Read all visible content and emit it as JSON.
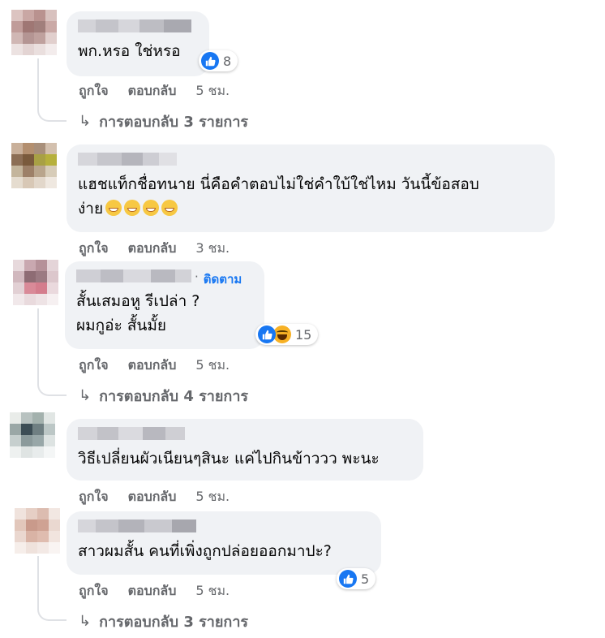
{
  "comments": [
    {
      "text_lines": [
        "พก.หรอ ใช่หรอ"
      ],
      "reaction_count": "8",
      "actions": {
        "like": "ถูกใจ",
        "reply": "ตอบกลับ",
        "time": "5 ชม."
      },
      "replies_label": "การตอบกลับ 3 รายการ"
    },
    {
      "text_lines": [
        "แฮชแท็กชื่อทนาย นี่คือคำตอบไม่ใช่คำใบ้ใช่ไหม วันนี้ข้อสอบ",
        "ง่าย"
      ],
      "actions": {
        "like": "ถูกใจ",
        "reply": "ตอบกลับ",
        "time": "3 ชม."
      }
    },
    {
      "follow_label": "ติดตาม",
      "text_lines": [
        "สั้นเสมอหู รีเปล่า ?",
        "ผมกูอ่ะ สั้นมั้ย"
      ],
      "reaction_count": "15",
      "actions": {
        "like": "ถูกใจ",
        "reply": "ตอบกลับ",
        "time": "5 ชม."
      },
      "replies_label": "การตอบกลับ 4 รายการ"
    },
    {
      "text_lines": [
        "วิธีเปลี่ยนผัวเนียนๆสินะ แค่ไปกินข้าววว พะนะ"
      ],
      "actions": {
        "like": "ถูกใจ",
        "reply": "ตอบกลับ",
        "time": "5 ชม."
      }
    },
    {
      "text_lines": [
        "สาวผมสั้น คนที่เพิ่งถูกปล่อยออกมาปะ?"
      ],
      "reaction_count": "5",
      "actions": {
        "like": "ถูกใจ",
        "reply": "ตอบกลับ",
        "time": "5 ชม."
      },
      "replies_label": "การตอบกลับ 3 รายการ"
    }
  ],
  "colors": {
    "bubble": "#f0f2f5",
    "meta": "#65676b",
    "accent": "#1877f2"
  },
  "icons": {
    "reply_arrow": "reply-arrow-icon",
    "like": "like-icon",
    "haha": "haha-icon",
    "grin": "grinning-emoji-icon"
  }
}
